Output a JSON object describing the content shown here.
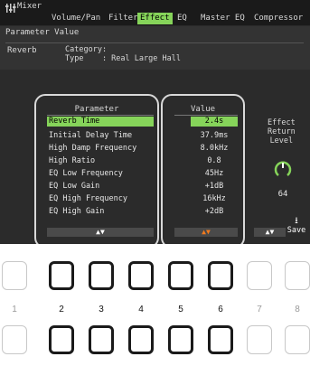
{
  "window": {
    "title": "Mixer",
    "tabs": [
      {
        "label": "Volume/Pan",
        "active": false
      },
      {
        "label": "Filter",
        "active": false
      },
      {
        "label": "Effect",
        "active": true
      },
      {
        "label": "EQ",
        "active": false
      },
      {
        "label": "Master EQ",
        "active": false
      },
      {
        "label": "Compressor",
        "active": false
      }
    ]
  },
  "section": {
    "title": "Parameter Value",
    "block_name": "Reverb",
    "category_line": "Category:",
    "type_line": "Type    : Real Large Hall"
  },
  "table": {
    "param_header": "Parameter",
    "value_header": "Value",
    "rows": [
      {
        "param": "Reverb Time",
        "value": "2.4s",
        "selected": true
      },
      {
        "param": "Initial Delay Time",
        "value": "37.9ms",
        "selected": false
      },
      {
        "param": "High Damp Frequency",
        "value": "8.0kHz",
        "selected": false
      },
      {
        "param": "High Ratio",
        "value": "0.8",
        "selected": false
      },
      {
        "param": "EQ Low Frequency",
        "value": "45Hz",
        "selected": false
      },
      {
        "param": "EQ Low Gain",
        "value": "+1dB",
        "selected": false
      },
      {
        "param": "EQ High Frequency",
        "value": "16kHz",
        "selected": false
      },
      {
        "param": "EQ High Gain",
        "value": "+2dB",
        "selected": false
      }
    ],
    "param_arrows": "▲▼",
    "value_arrows": "▲▼"
  },
  "effect_return": {
    "label_lines": [
      "Effect",
      "Return",
      "Level"
    ],
    "value": "64",
    "arrows": "▲▼"
  },
  "save": {
    "label": "Save",
    "icon": "save-download-icon"
  },
  "hardware_buttons": {
    "numbers": [
      "1",
      "2",
      "3",
      "4",
      "5",
      "6",
      "7",
      "8"
    ],
    "active": [
      false,
      true,
      true,
      true,
      true,
      true,
      false,
      false
    ]
  },
  "colors": {
    "accent": "#86d45a",
    "value_arrow": "#f07a1e",
    "screen_bg": "#2b2b2b"
  }
}
